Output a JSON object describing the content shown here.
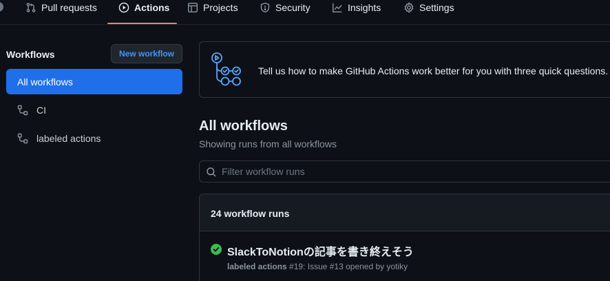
{
  "nav": {
    "tabs": [
      {
        "label": "Pull requests",
        "icon": "git-pull-request-icon"
      },
      {
        "label": "Actions",
        "icon": "play-circle-icon",
        "selected": true
      },
      {
        "label": "Projects",
        "icon": "table-icon"
      },
      {
        "label": "Security",
        "icon": "shield-icon"
      },
      {
        "label": "Insights",
        "icon": "graph-icon"
      },
      {
        "label": "Settings",
        "icon": "gear-icon"
      }
    ],
    "accent_color": "#f78166"
  },
  "sidebar": {
    "title": "Workflows",
    "new_workflow_label": "New workflow",
    "items": [
      {
        "label": "All workflows",
        "active": true
      },
      {
        "label": "CI",
        "icon": "workflow-icon"
      },
      {
        "label": "labeled actions",
        "icon": "workflow-icon"
      }
    ],
    "active_color": "#1f6feb"
  },
  "banner": {
    "text": "Tell us how to make GitHub Actions work better for you with three quick questions.",
    "icon": "actions-illustration-icon"
  },
  "main": {
    "title": "All workflows",
    "subtitle": "Showing runs from all workflows",
    "filter_placeholder": "Filter workflow runs",
    "runs_count_label": "24 workflow runs",
    "runs": [
      {
        "title": "SlackToNotionの記事を書き終えそう",
        "workflow": "labeled actions",
        "details": "#19: Issue #13 opened by yotiky",
        "status": "success",
        "status_icon": "check-circle-fill-icon",
        "status_color": "#3fb950"
      }
    ]
  }
}
